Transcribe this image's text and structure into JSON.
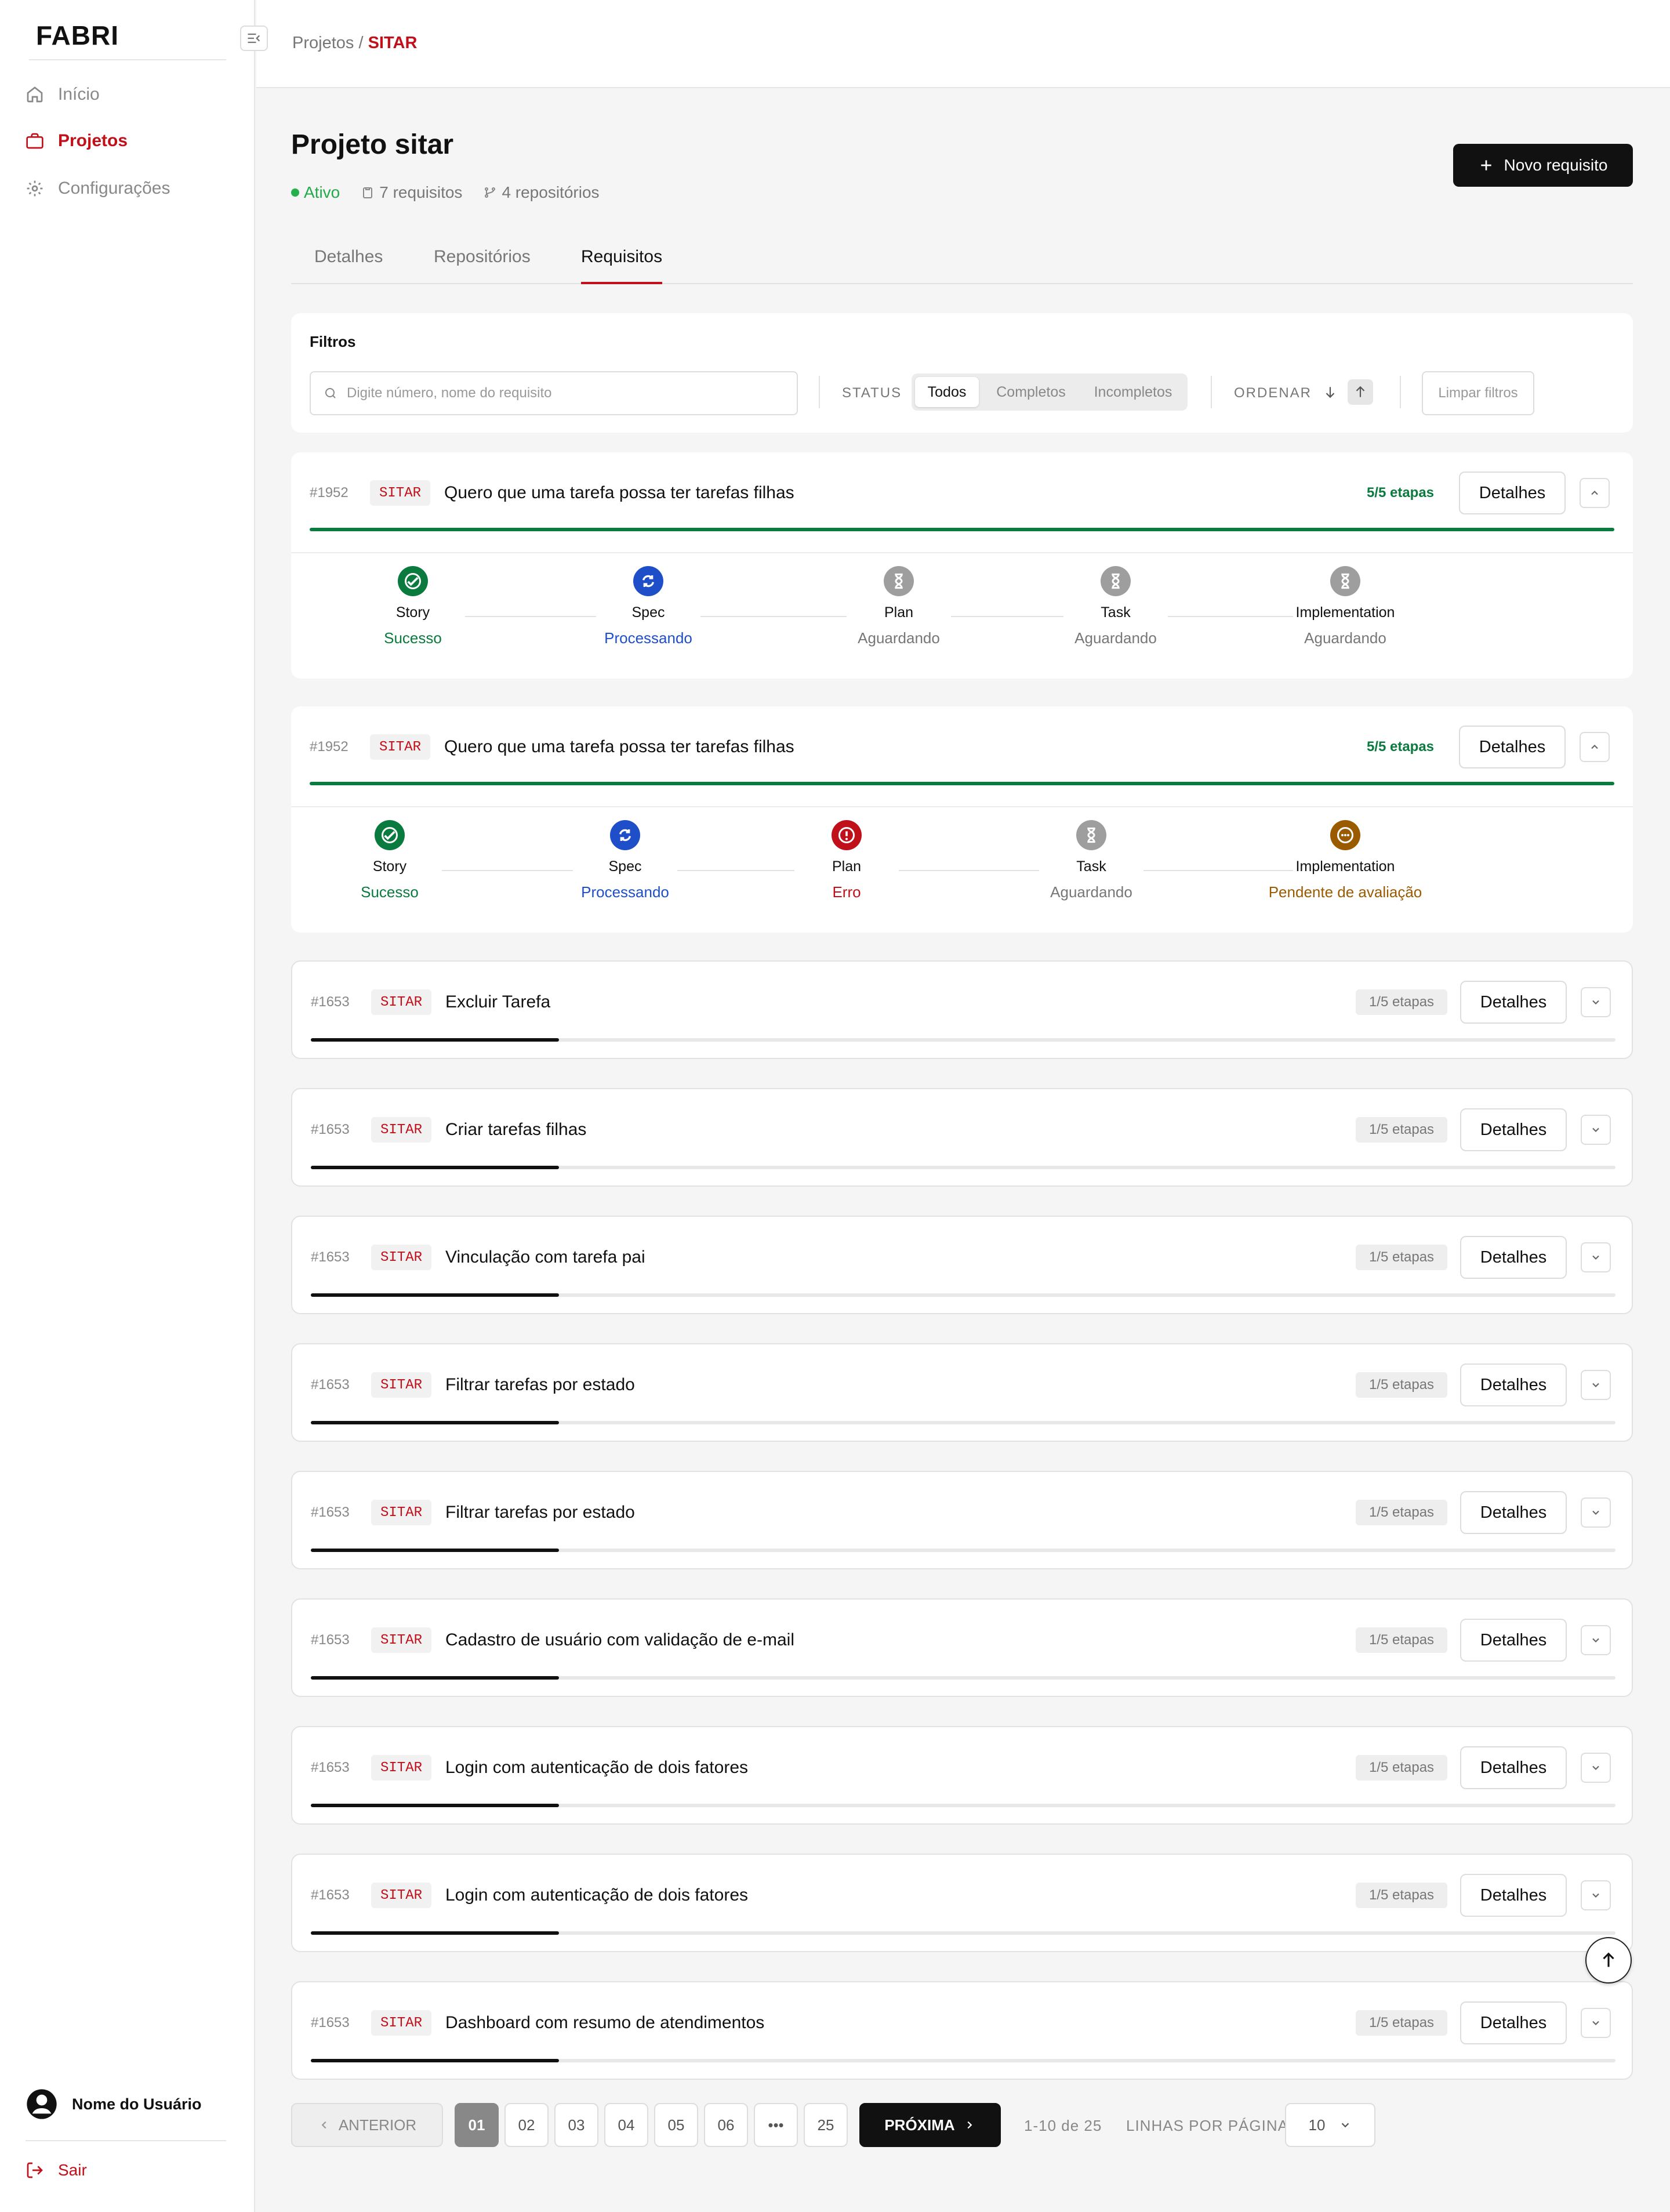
{
  "sidebar": {
    "logo": "FABRI",
    "nav": [
      {
        "label": "Início",
        "icon": "home-icon"
      },
      {
        "label": "Projetos",
        "icon": "briefcase-icon"
      },
      {
        "label": "Configurações",
        "icon": "gear-icon"
      }
    ],
    "user": "Nome do Usuário",
    "logout": "Sair"
  },
  "breadcrumb": {
    "parent": "Projetos",
    "sep": "/",
    "current": "SITAR"
  },
  "project": {
    "title": "Projeto sitar",
    "status": "Ativo",
    "requirements": "7 requisitos",
    "repositories": "4 repositórios",
    "new_button": "Novo requisito"
  },
  "tabs": [
    "Detalhes",
    "Repositórios",
    "Requisitos"
  ],
  "filters": {
    "title": "Filtros",
    "search_placeholder": "Digite número, nome do requisito",
    "status_label": "STATUS",
    "status_options": [
      "Todos",
      "Completos",
      "Incompletos"
    ],
    "status_selected": "Todos",
    "order_label": "ORDENAR",
    "clear": "Limpar filtros"
  },
  "details_label": "Detalhes",
  "requirements": [
    {
      "id": "#1952",
      "tag": "SITAR",
      "title": "Quero que uma tarefa possa ter tarefas filhas",
      "steps": "5/5 etapas",
      "progress": 1.0,
      "expanded": true,
      "stages": [
        {
          "name": "Story",
          "status": "Sucesso"
        },
        {
          "name": "Spec",
          "status": "Processando"
        },
        {
          "name": "Plan",
          "status": "Aguardando"
        },
        {
          "name": "Task",
          "status": "Aguardando"
        },
        {
          "name": "Implementation",
          "status": "Aguardando"
        }
      ]
    },
    {
      "id": "#1952",
      "tag": "SITAR",
      "title": "Quero que uma tarefa possa ter tarefas filhas",
      "steps": "5/5 etapas",
      "progress": 1.0,
      "expanded": true,
      "stages": [
        {
          "name": "Story",
          "status": "Sucesso"
        },
        {
          "name": "Spec",
          "status": "Processando"
        },
        {
          "name": "Plan",
          "status": "Erro"
        },
        {
          "name": "Task",
          "status": "Aguardando"
        },
        {
          "name": "Implementation",
          "status": "Pendente de avaliação"
        }
      ]
    },
    {
      "id": "#1653",
      "tag": "SITAR",
      "title": "Excluir Tarefa",
      "steps": "1/5 etapas",
      "progress": 0.19,
      "expanded": false
    },
    {
      "id": "#1653",
      "tag": "SITAR",
      "title": "Criar tarefas filhas",
      "steps": "1/5 etapas",
      "progress": 0.19,
      "expanded": false
    },
    {
      "id": "#1653",
      "tag": "SITAR",
      "title": "Vinculação com tarefa pai",
      "steps": "1/5 etapas",
      "progress": 0.19,
      "expanded": false
    },
    {
      "id": "#1653",
      "tag": "SITAR",
      "title": "Filtrar tarefas por estado",
      "steps": "1/5 etapas",
      "progress": 0.19,
      "expanded": false
    },
    {
      "id": "#1653",
      "tag": "SITAR",
      "title": "Filtrar tarefas por estado",
      "steps": "1/5 etapas",
      "progress": 0.19,
      "expanded": false
    },
    {
      "id": "#1653",
      "tag": "SITAR",
      "title": "Cadastro de usuário com validação de e-mail",
      "steps": "1/5 etapas",
      "progress": 0.19,
      "expanded": false
    },
    {
      "id": "#1653",
      "tag": "SITAR",
      "title": "Login com autenticação de dois fatores",
      "steps": "1/5 etapas",
      "progress": 0.19,
      "expanded": false
    },
    {
      "id": "#1653",
      "tag": "SITAR",
      "title": "Login com autenticação de dois fatores",
      "steps": "1/5 etapas",
      "progress": 0.19,
      "expanded": false
    },
    {
      "id": "#1653",
      "tag": "SITAR",
      "title": "Dashboard com resumo de atendimentos",
      "steps": "1/5 etapas",
      "progress": 0.19,
      "expanded": false
    }
  ],
  "status_colors": {
    "Sucesso": "#0a7a3e",
    "Processando": "#1f4fc8",
    "Aguardando": "#777777",
    "Erro": "#c0101a",
    "Pendente de avaliação": "#9a5a00"
  },
  "stage_icon_colors": {
    "Sucesso": "#0a7a3e",
    "Processando": "#1f4fc8",
    "Aguardando": "#9e9e9e",
    "Erro": "#c0101a",
    "Pendente de avaliação": "#9a5a00"
  },
  "pagination": {
    "prev": "ANTERIOR",
    "pages": [
      "01",
      "02",
      "03",
      "04",
      "05",
      "06",
      "•••",
      "25"
    ],
    "current": "01",
    "next": "PRÓXIMA",
    "range": "1-10 de 25",
    "rows_label": "LINHAS POR PÁGINA",
    "rows_value": "10"
  }
}
